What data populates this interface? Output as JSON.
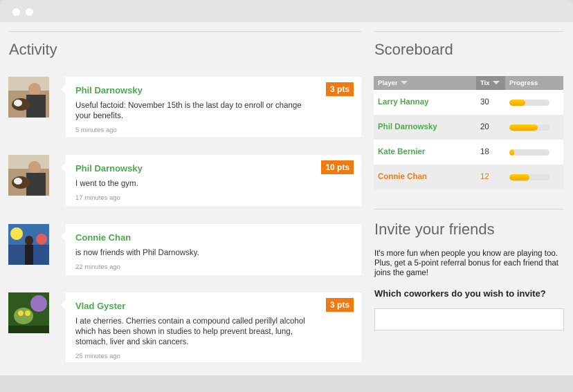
{
  "activity": {
    "title": "Activity",
    "items": [
      {
        "name": "Phil Darnowsky",
        "text": "Useful factoid: November 15th is the last day to enroll or change your benefits.",
        "time": "5 minutes ago",
        "points": "3 pts"
      },
      {
        "name": "Phil Darnowsky",
        "text": "I went to the gym.",
        "time": "17 minutes ago",
        "points": "10 pts"
      },
      {
        "name": "Connie Chan",
        "text": "is now friends with Phil Darnowsky.",
        "time": "22 minutes ago",
        "points": ""
      },
      {
        "name": "Vlad Gyster",
        "text": "I ate cherries. Cherries contain a compound called perillyl alcohol which has been shown in studies to help prevent breast, lung, stomach, liver and skin cancers.",
        "time": "25 minutes ago",
        "points": "3 pts"
      }
    ]
  },
  "scoreboard": {
    "title": "Scoreboard",
    "headers": {
      "player": "Player",
      "tix": "Tix",
      "progress": "Progress"
    },
    "rows": [
      {
        "player": "Larry Hannay",
        "tix": "30",
        "progress": 0.4
      },
      {
        "player": "Phil Darnowsky",
        "tix": "20",
        "progress": 0.7
      },
      {
        "player": "Kate Bernier",
        "tix": "18",
        "progress": 0.12
      },
      {
        "player": "Connie Chan",
        "tix": "12",
        "progress": 0.5,
        "highlighted": true
      }
    ]
  },
  "invite": {
    "title": "Invite your friends",
    "text": "It's more fun when people you know are playing too. Plus, get a 5-point referral bonus for each friend that joins the game!",
    "question": "Which coworkers do you wish to invite?",
    "input_value": "",
    "input_placeholder": ""
  },
  "colors": {
    "accent_green": "#4caa4c",
    "accent_orange": "#f07a10",
    "progress_yellow": "#ffd000"
  }
}
